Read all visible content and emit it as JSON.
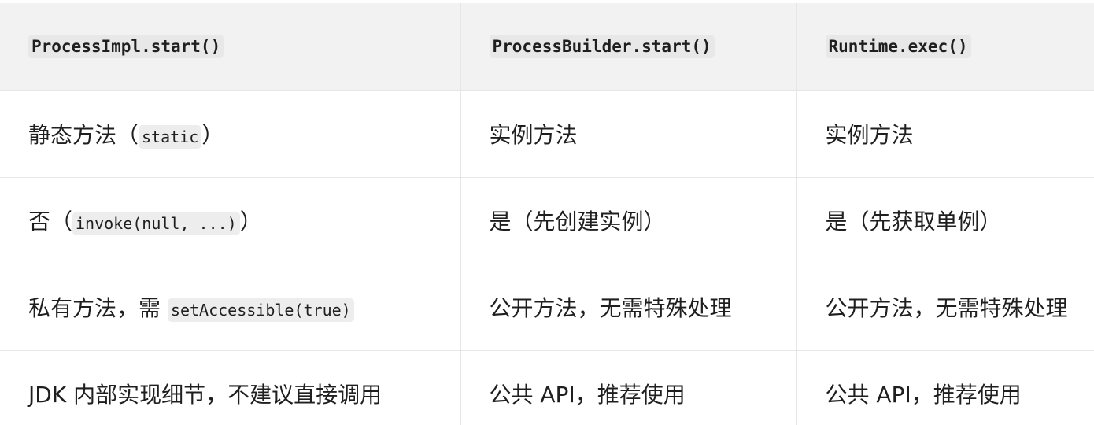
{
  "table": {
    "headers": [
      "ProcessImpl.start()",
      "ProcessBuilder.start()",
      "Runtime.exec()"
    ],
    "rows": [
      {
        "c0_text": "静态方法（",
        "c0_code": "static",
        "c0_suffix": "）",
        "c1": "实例方法",
        "c2": "实例方法"
      },
      {
        "c0_text": "否（",
        "c0_code": "invoke(null, ...)",
        "c0_suffix": "）",
        "c1": "是（先创建实例）",
        "c2": "是（先获取单例）"
      },
      {
        "c0_text": "私有方法，需 ",
        "c0_code": "setAccessible(true)",
        "c0_suffix": "",
        "c1": "公开方法，无需特殊处理",
        "c2": "公开方法，无需特殊处理"
      },
      {
        "c0_text": "JDK 内部实现细节，不建议直接调用",
        "c0_code": "",
        "c0_suffix": "",
        "c1": "公共 API，推荐使用",
        "c2": "公共 API，推荐使用"
      }
    ]
  }
}
